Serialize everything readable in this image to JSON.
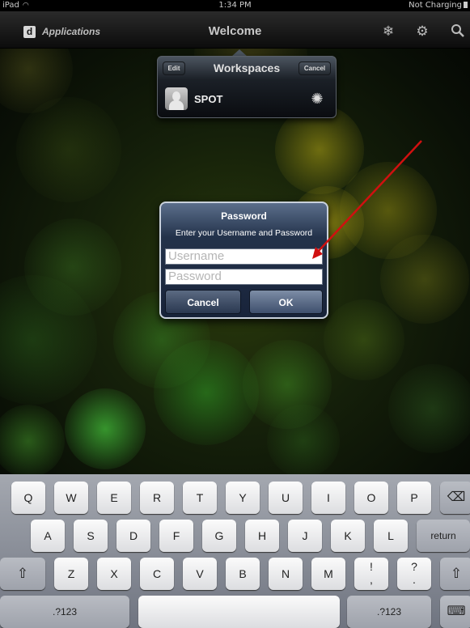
{
  "status_bar": {
    "device": "iPad",
    "time": "1:34 PM",
    "battery_status": "Not Charging"
  },
  "nav": {
    "app_label": "Applications",
    "app_logo": "d",
    "title": "Welcome",
    "icons": [
      "snowflake-icon",
      "gear-icon",
      "search-icon"
    ]
  },
  "popover": {
    "title": "Workspaces",
    "edit_label": "Edit",
    "cancel_label": "Cancel",
    "items": [
      {
        "label": "SPOT"
      }
    ]
  },
  "dialog": {
    "title": "Password",
    "message": "Enter your Username and Password",
    "username_placeholder": "Username",
    "password_placeholder": "Password",
    "cancel_label": "Cancel",
    "ok_label": "OK"
  },
  "keyboard": {
    "row1": [
      "Q",
      "W",
      "E",
      "R",
      "T",
      "Y",
      "U",
      "I",
      "O",
      "P"
    ],
    "row2": [
      "A",
      "S",
      "D",
      "F",
      "G",
      "H",
      "J",
      "K",
      "L"
    ],
    "row2_return": "return",
    "row3": [
      "Z",
      "X",
      "C",
      "V",
      "B",
      "N",
      "M"
    ],
    "row3_punct": [
      [
        "!",
        ","
      ],
      [
        "?",
        "."
      ]
    ],
    "numbers_label": ".?123",
    "shift_glyph": "⇧",
    "delete_glyph": "⌫",
    "hide_glyph": "⌨"
  },
  "colors": {
    "arrow": "#d01010",
    "dialog_accent": "#23324a"
  }
}
